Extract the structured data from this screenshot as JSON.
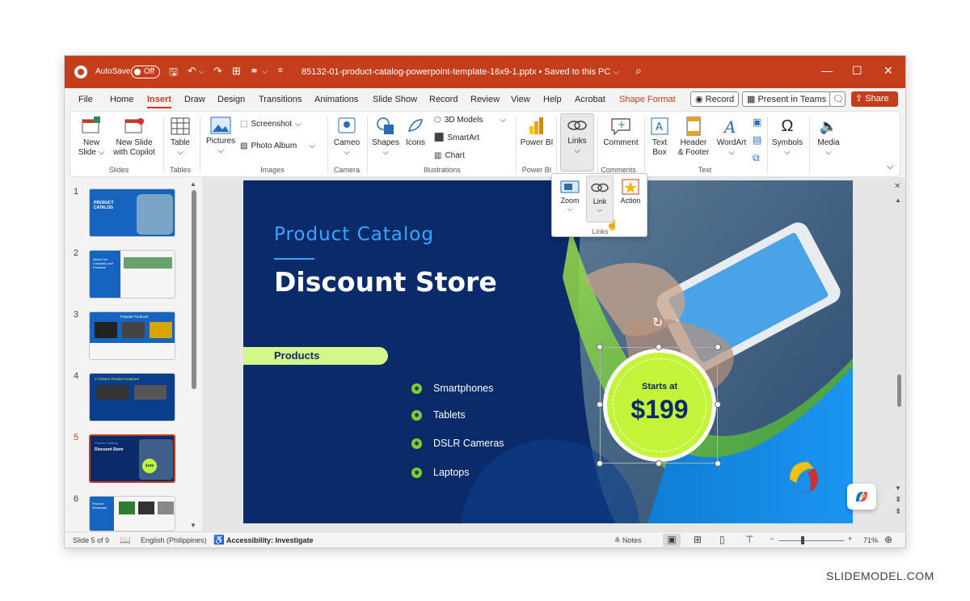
{
  "titlebar": {
    "autosave_label": "AutoSave",
    "autosave_state": "Off",
    "filename": "85132-01-product-catalog-powerpoint-template-16x9-1.pptx • Saved to this PC ⌵",
    "accent": "#c43e1c"
  },
  "menu": {
    "tabs": [
      "File",
      "Home",
      "Insert",
      "Draw",
      "Design",
      "Transitions",
      "Animations",
      "Slide Show",
      "Record",
      "Review",
      "View",
      "Help",
      "Acrobat",
      "Shape Format"
    ],
    "active": "Insert",
    "record_label": "Record",
    "present_label": "Present in Teams",
    "share_label": "Share"
  },
  "ribbon": {
    "new_slide": "New Slide",
    "new_slide_copilot": "New Slide with Copilot",
    "table": "Table",
    "pictures": "Pictures",
    "screenshot": "Screenshot",
    "photo_album": "Photo Album",
    "cameo": "Cameo",
    "shapes": "Shapes",
    "icons": "Icons",
    "models3d": "3D Models",
    "smartart": "SmartArt",
    "chart": "Chart",
    "powerbi": "Power BI",
    "links": "Links",
    "comment": "Comment",
    "textbox": "Text Box",
    "header_footer": "Header & Footer",
    "wordart": "WordArt",
    "symbols": "Symbols",
    "media": "Media",
    "groups": {
      "slides": "Slides",
      "tables": "Tables",
      "images": "Images",
      "camera": "Camera",
      "illustrations": "Illustrations",
      "powerbi": "Power BI",
      "comments": "Comments",
      "text": "Text"
    }
  },
  "links_popup": {
    "zoom": "Zoom",
    "link": "Link",
    "action": "Action",
    "group": "Links"
  },
  "thumbnails": {
    "numbers": [
      "1",
      "2",
      "3",
      "4",
      "5",
      "6"
    ],
    "selected": "5",
    "t1_title": "PRODUCT CATALOG",
    "t2_title": "About Our Company and Products",
    "t3_title": "Popular Products",
    "t4_title": "2 Column Product Features",
    "t5_title": "Discount Store",
    "t5_sub": "Product Catalog",
    "t5_price": "$199",
    "t6_title": "Product Showcase"
  },
  "slide": {
    "subtitle": "Product Catalog",
    "title": "Discount Store",
    "products_label": "Products",
    "items": [
      "Smartphones",
      "Tablets",
      "DSLR Cameras",
      "Laptops"
    ],
    "badge_top": "Starts at",
    "badge_price": "$199",
    "bg": "#0a2a6a",
    "green": "#c4f43a"
  },
  "status": {
    "slide_of": "Slide 5 of 9",
    "language": "English (Philippines)",
    "accessibility": "Accessibility: Investigate",
    "notes": "Notes",
    "zoom": "71%"
  },
  "watermark": "SLIDEMODEL.COM"
}
